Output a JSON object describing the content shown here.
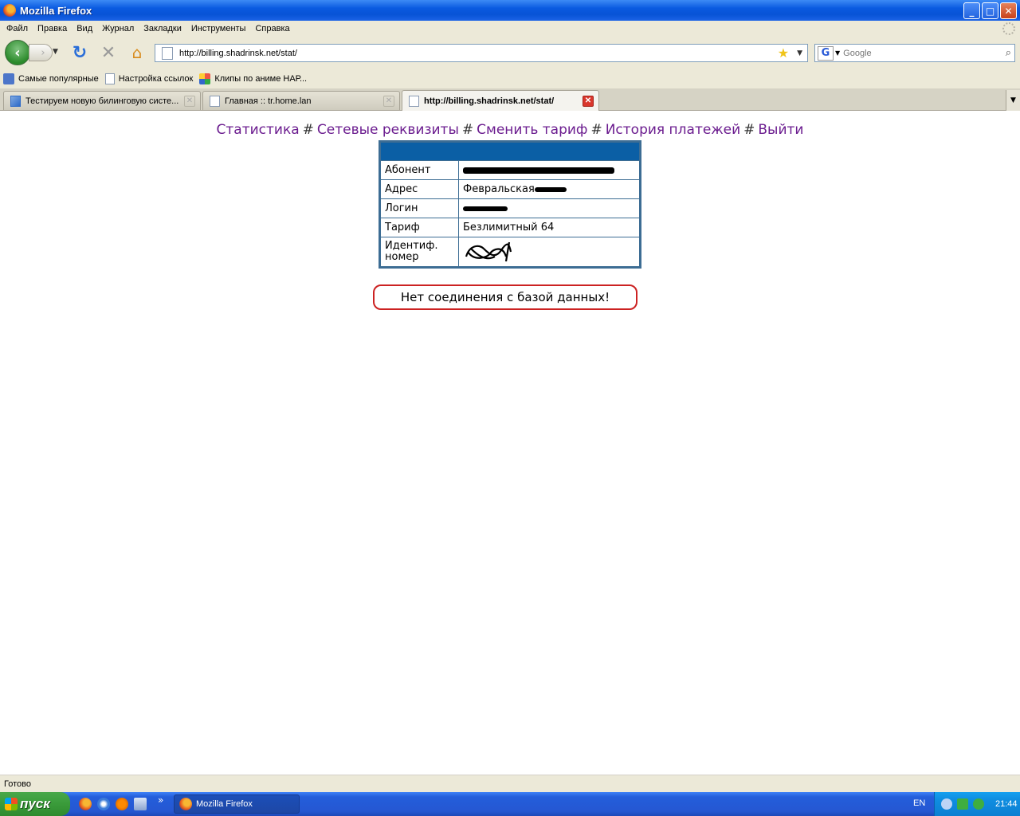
{
  "window": {
    "title": "Mozilla Firefox",
    "controls": {
      "minimize": "_",
      "maximize": "□",
      "close": "✕"
    }
  },
  "menu": [
    "Файл",
    "Правка",
    "Вид",
    "Журнал",
    "Закладки",
    "Инструменты",
    "Справка"
  ],
  "toolbar": {
    "url": "http://billing.shadrinsk.net/stat/",
    "search_placeholder": "Google",
    "search_engine_letter": "G"
  },
  "bookmarks": [
    {
      "label": "Самые популярные",
      "icon": "most-visited-icon"
    },
    {
      "label": "Настройка ссылок",
      "icon": "page-icon"
    },
    {
      "label": "Клипы по аниме НАР...",
      "icon": "clips-icon"
    }
  ],
  "tabs": [
    {
      "label": "Тестируем новую билинговую систе...",
      "active": false
    },
    {
      "label": "Главная :: tr.home.lan",
      "active": false
    },
    {
      "label": "http://billing.shadrinsk.net/stat/",
      "active": true
    }
  ],
  "page": {
    "nav": [
      "Статистика",
      "Сетевые реквизиты",
      "Сменить тариф",
      "История платежей",
      "Выйти"
    ],
    "nav_separator": "#",
    "table": {
      "rows": [
        {
          "label": "Абонент",
          "value": ""
        },
        {
          "label": "Адрес",
          "value": "Февральская"
        },
        {
          "label": "Логин",
          "value": ""
        },
        {
          "label": "Тариф",
          "value": "Безлимитный 64"
        },
        {
          "label": "Идентиф. номер",
          "value": ""
        }
      ],
      "header_color": "#0b5fa5",
      "border_color": "#3d6d94"
    },
    "error": "Нет соединения с базой данных!",
    "error_color": "#cc2222",
    "link_color": "#6b1c8f"
  },
  "status": {
    "text": "Готово"
  },
  "taskbar": {
    "start": "пуск",
    "task": "Mozilla Firefox",
    "lang": "EN",
    "clock": "21:44",
    "quick_launch_more": "»"
  }
}
